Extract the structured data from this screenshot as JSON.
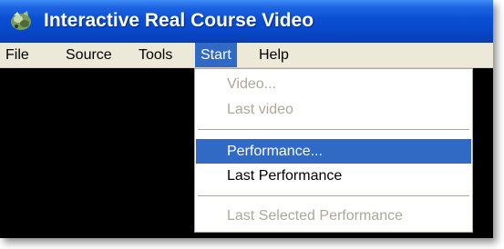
{
  "window": {
    "title": "Interactive Real Course Video",
    "icon": "app-logo-icon",
    "colors": {
      "titlebar": "#0a4fd4",
      "menubar": "#ece9d8",
      "highlight": "#316ac5",
      "client": "#000000",
      "disabled_text": "#aca899"
    }
  },
  "menubar": {
    "items": [
      {
        "label": "File"
      },
      {
        "label": "Source"
      },
      {
        "label": "Tools"
      },
      {
        "label": "Start"
      },
      {
        "label": "Help"
      }
    ],
    "active": "Start"
  },
  "start_menu": {
    "items": [
      {
        "label": "Video...",
        "state": "disabled"
      },
      {
        "label": "Last video",
        "state": "disabled"
      },
      {
        "label": "Performance...",
        "state": "highlighted"
      },
      {
        "label": "Last Performance",
        "state": "enabled"
      },
      {
        "label": "Last Selected Performance",
        "state": "disabled"
      }
    ]
  }
}
